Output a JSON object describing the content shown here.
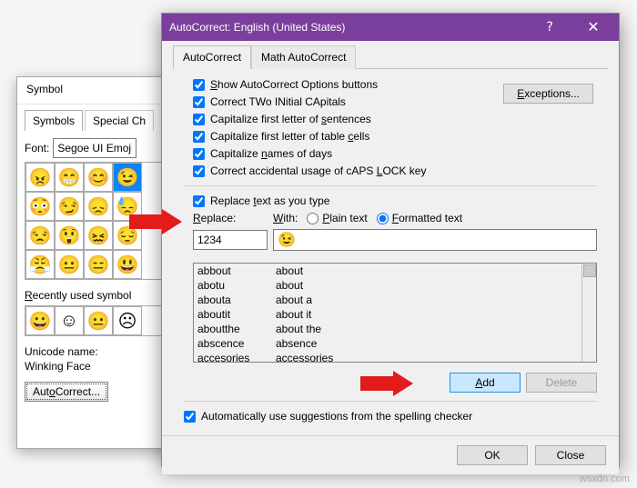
{
  "symbol_dialog": {
    "title": "Symbol",
    "tabs": [
      "Symbols",
      "Special Ch"
    ],
    "font_label": "Font:",
    "font_value": "Segoe UI Emoji",
    "recent_label": "Recently used symbol",
    "unicode_label": "Unicode name:",
    "unicode_value": "Winking Face",
    "autocorrect_btn": "AutoCorrect...",
    "emoji_grid": [
      "😠",
      "😁",
      "😊",
      "😉",
      "😳",
      "😏",
      "😞",
      "😓",
      "😒",
      "😲",
      "😖",
      "😔",
      "😤",
      "😐",
      "😑",
      "😃"
    ],
    "recent_grid": [
      "😀",
      "☺",
      "😐",
      "☹"
    ]
  },
  "ac_dialog": {
    "title": "AutoCorrect: English (United States)",
    "help_icon": "?",
    "close_icon": "✕",
    "tabs": {
      "autocorrect": "AutoCorrect",
      "math": "Math AutoCorrect"
    },
    "show_opts": "Show AutoCorrect Options buttons",
    "correct_two": "Correct TWo INitial CApitals",
    "cap_sentence": "Capitalize first letter of sentences",
    "cap_table": "Capitalize first letter of table cells",
    "cap_days": "Capitalize names of days",
    "caps_lock": "Correct accidental usage of cAPS LOCK key",
    "exceptions": "Exceptions...",
    "replace_as_type": "Replace text as you type",
    "replace_label": "Replace:",
    "with_label": "With:",
    "plain_text": "Plain text",
    "formatted_text": "Formatted text",
    "replace_value": "1234",
    "with_emoji": "😉",
    "table": [
      {
        "k": "abbout",
        "v": "about"
      },
      {
        "k": "abotu",
        "v": "about"
      },
      {
        "k": "abouta",
        "v": "about a"
      },
      {
        "k": "aboutit",
        "v": "about it"
      },
      {
        "k": "aboutthe",
        "v": "about the"
      },
      {
        "k": "abscence",
        "v": "absence"
      },
      {
        "k": "accesories",
        "v": "accessories"
      }
    ],
    "add_btn": "Add",
    "delete_btn": "Delete",
    "auto_suggest": "Automatically use suggestions from the spelling checker",
    "ok": "OK",
    "close": "Close"
  },
  "watermark": "wsxdn.com"
}
